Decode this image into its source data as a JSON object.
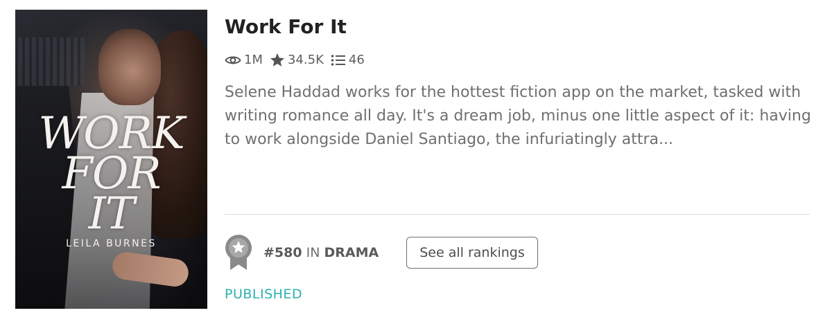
{
  "cover": {
    "title_lines": [
      "WORK",
      "FOR",
      "IT"
    ],
    "author": "LEILA BURNES"
  },
  "story": {
    "title": "Work For It",
    "description": "Selene Haddad works for the hottest fiction app on the market, tasked with writing romance all day. It's a dream job, minus one little aspect of it: having to work alongside Daniel Santiago, the infuriatingly attra...",
    "status": "PUBLISHED"
  },
  "stats": {
    "reads": "1M",
    "votes": "34.5K",
    "parts": "46"
  },
  "ranking": {
    "number": "#580",
    "in_label": "IN",
    "category": "DRAMA",
    "button_label": "See all rankings"
  },
  "icons": {
    "reads": "eye-icon",
    "votes": "star-icon",
    "parts": "list-icon",
    "ranking": "award-ribbon-icon"
  },
  "colors": {
    "status": "#2cb1ae",
    "text": "#6f6f6f",
    "title": "#222222"
  }
}
